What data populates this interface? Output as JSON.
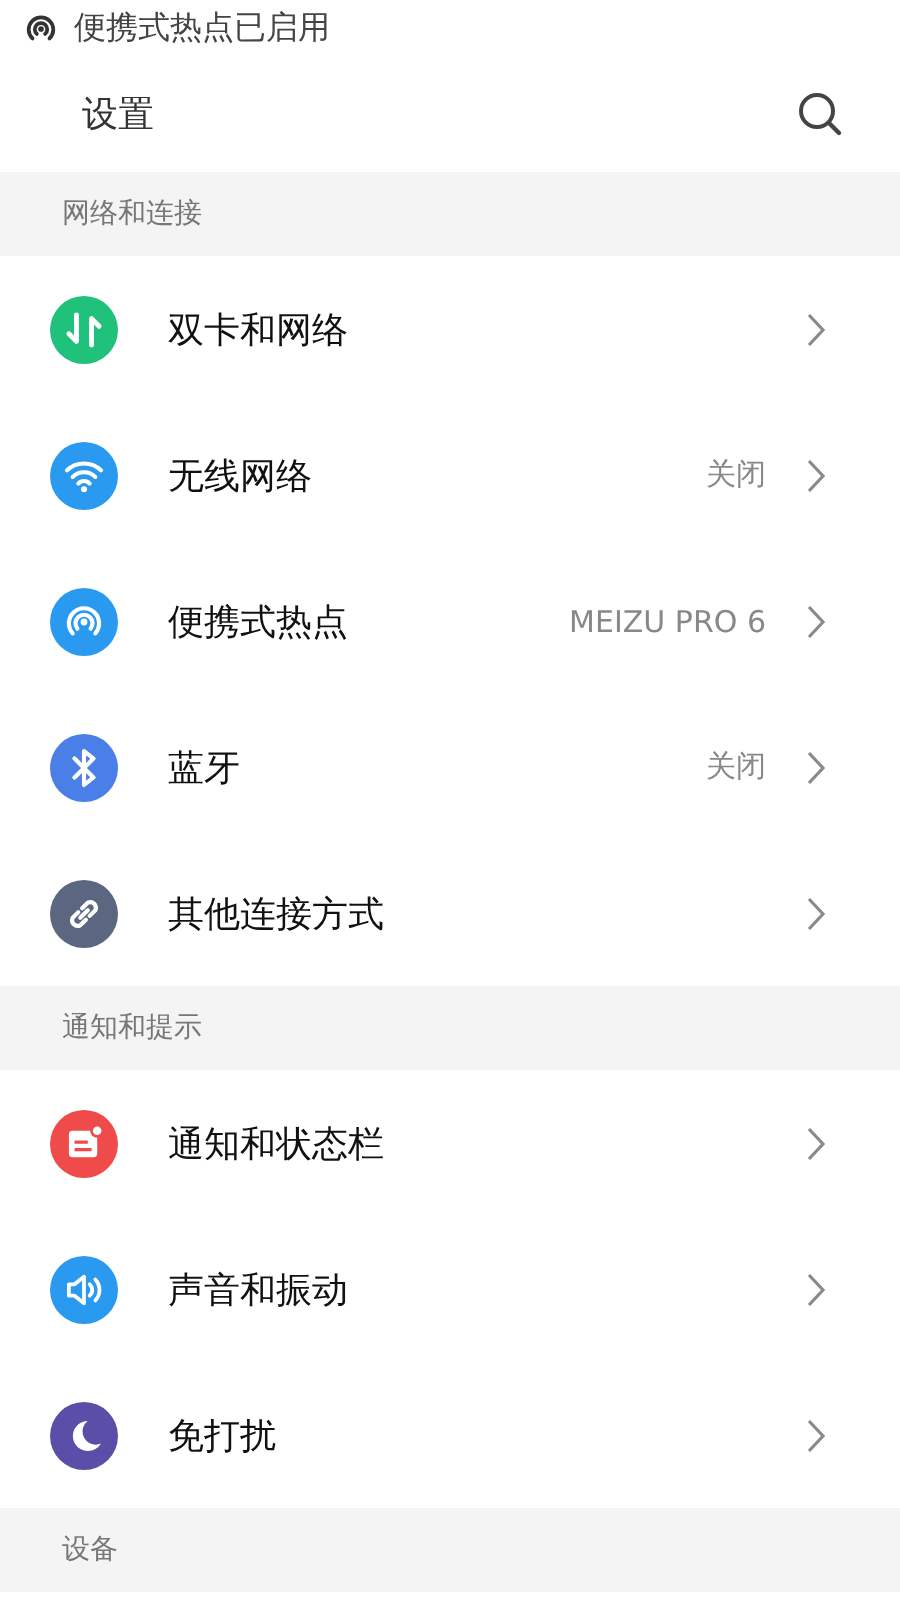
{
  "status_bar": {
    "notification": "便携式热点已启用"
  },
  "header": {
    "title": "设置"
  },
  "sections": [
    {
      "title": "网络和连接",
      "items": [
        {
          "label": "双卡和网络",
          "color": "#1fc17b"
        },
        {
          "label": "无线网络",
          "value": "关闭",
          "color": "#2a9af0"
        },
        {
          "label": "便携式热点",
          "value": "MEIZU PRO 6",
          "color": "#2a9af0"
        },
        {
          "label": "蓝牙",
          "value": "关闭",
          "color": "#4b7fe8"
        },
        {
          "label": "其他连接方式",
          "color": "#5b6680"
        }
      ]
    },
    {
      "title": "通知和提示",
      "items": [
        {
          "label": "通知和状态栏",
          "color": "#ef4b4b"
        },
        {
          "label": "声音和振动",
          "color": "#2a9af0"
        },
        {
          "label": "免打扰",
          "color": "#5a4fa8"
        }
      ]
    },
    {
      "title": "设备"
    }
  ]
}
